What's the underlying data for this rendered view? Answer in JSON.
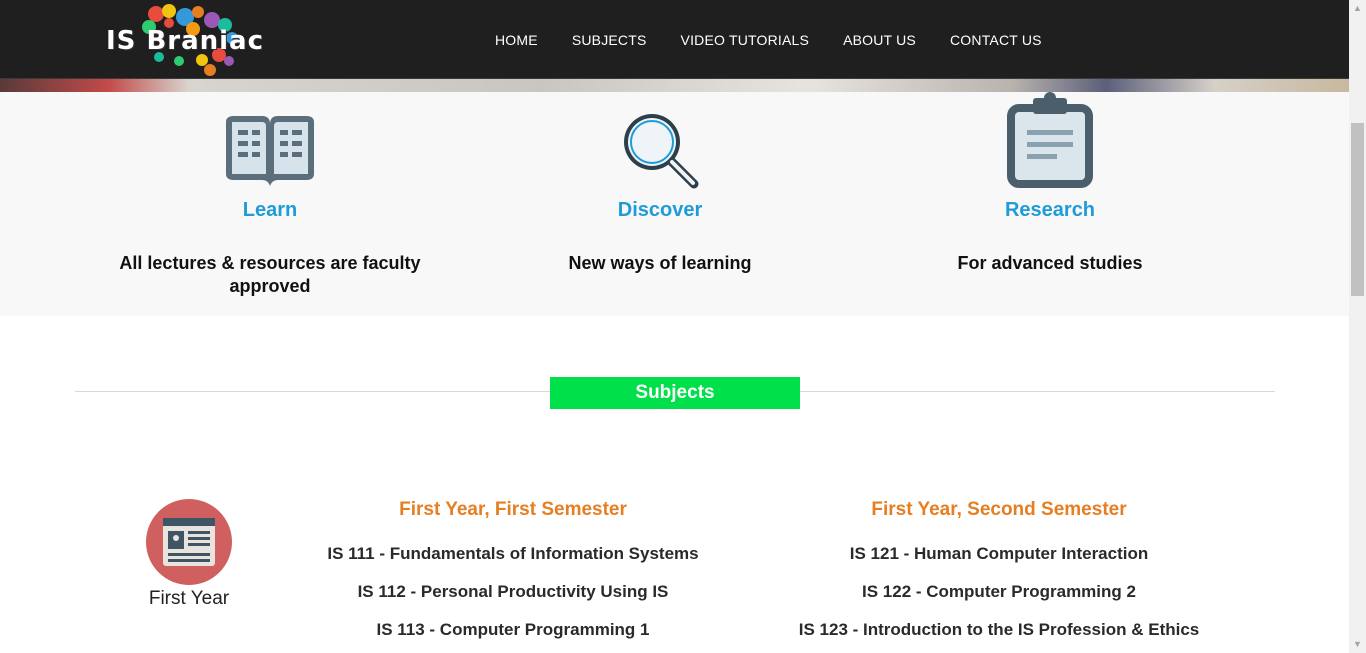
{
  "brand": {
    "logo_text": "IS Braniac"
  },
  "nav": {
    "items": [
      "HOME",
      "SUBJECTS",
      "VIDEO TUTORIALS",
      "ABOUT US",
      "CONTACT US"
    ]
  },
  "features": [
    {
      "icon": "open-book-icon",
      "title": "Learn",
      "description": "All lectures & resources are faculty approved"
    },
    {
      "icon": "magnifier-icon",
      "title": "Discover",
      "description": "New ways of learning"
    },
    {
      "icon": "clipboard-icon",
      "title": "Research",
      "description": "For advanced studies"
    }
  ],
  "subjects": {
    "heading": "Subjects",
    "year": {
      "label": "First Year",
      "icon": "newspaper-icon"
    },
    "semesters": [
      {
        "title": "First Year, First Semester",
        "courses": [
          "IS 111 - Fundamentals of Information Systems",
          "IS 112 - Personal Productivity Using IS",
          "IS 113 - Computer Programming 1"
        ]
      },
      {
        "title": "First Year, Second Semester",
        "courses": [
          "IS 121 - Human Computer Interaction",
          "IS 122 - Computer Programming 2",
          "IS 123 - Introduction to the IS Profession & Ethics"
        ]
      }
    ]
  },
  "colors": {
    "header_bg": "#1f1f1f",
    "accent_blue": "#1f9cd8",
    "subjects_green": "#00e04a",
    "semester_orange": "#e67e22",
    "year_circle": "#d05f5f"
  }
}
